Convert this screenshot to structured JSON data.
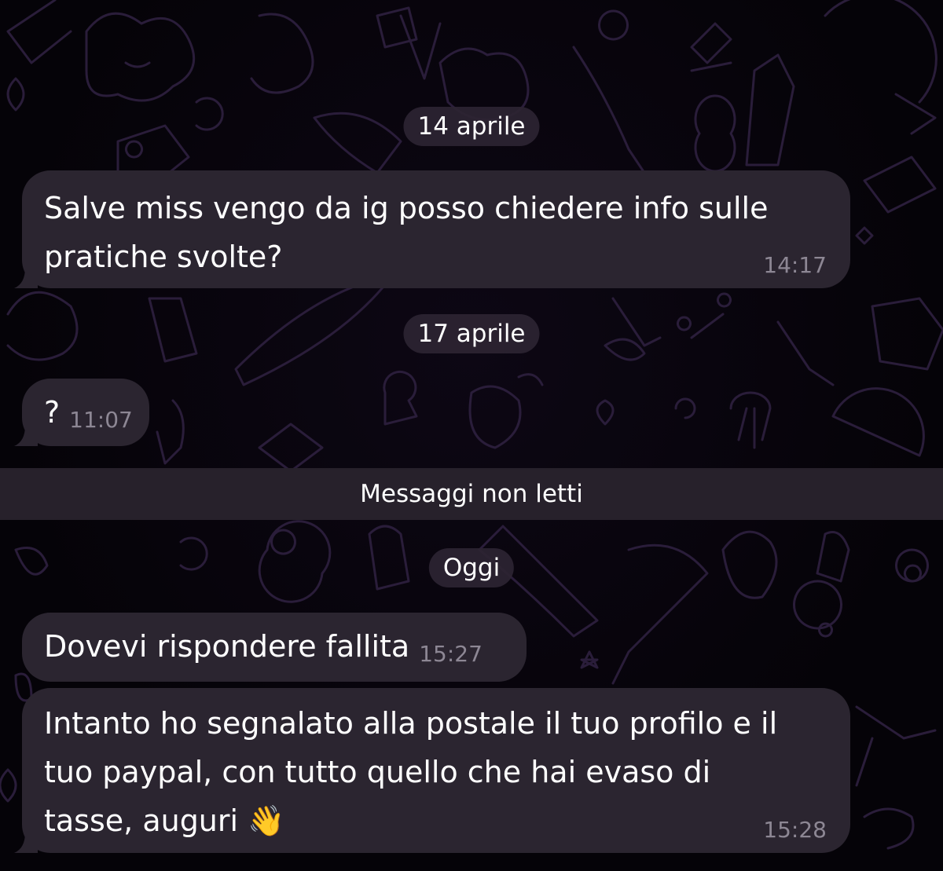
{
  "messages_view": {
    "date_separators": {
      "first": "14 aprile",
      "second": "17 aprile",
      "third": "Oggi"
    },
    "unread_separator": "Messaggi non letti",
    "messages": [
      {
        "text": "Salve miss vengo da ig posso chiedere info sulle\npratiche svolte?",
        "time": "14:17"
      },
      {
        "text": "?",
        "time": "11:07"
      },
      {
        "text": "Dovevi rispondere fallita",
        "time": "15:27"
      },
      {
        "text": "Intanto ho segnalato alla postale il tuo profilo e il\ntuo paypal, con tutto quello che hai evaso di\ntasse, auguri 👋",
        "time": "15:28"
      }
    ]
  },
  "colors": {
    "background": "#050308",
    "bubble": "#2b2530",
    "date_pill": "#2c2432",
    "unread_bar": "#27212b",
    "timestamp": "#8d8794",
    "doodle_stroke": "#2a1d3a"
  }
}
